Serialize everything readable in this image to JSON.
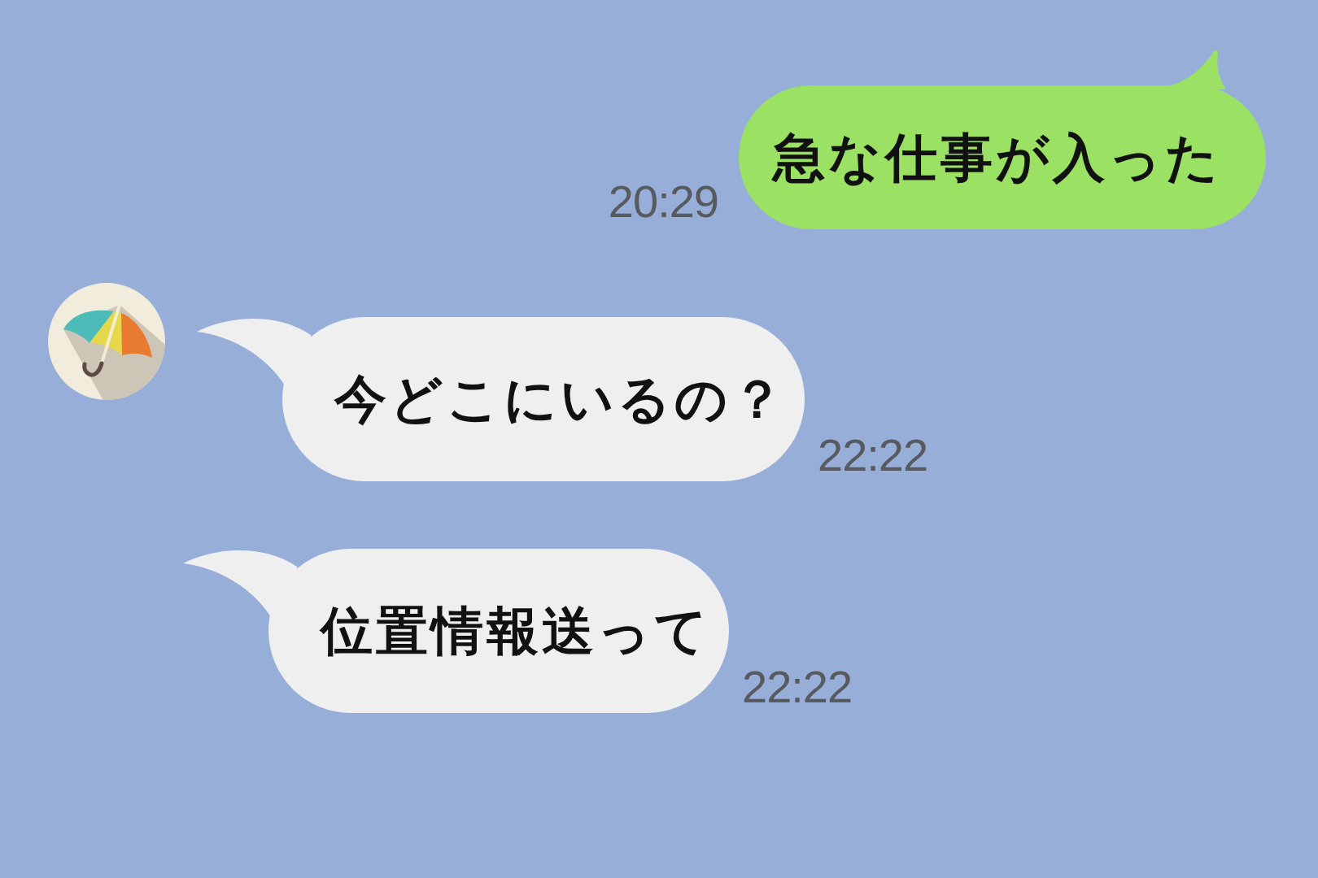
{
  "messages": [
    {
      "kind": "outgoing",
      "text": "急な仕事が入った",
      "time": "20:29",
      "avatar": false
    },
    {
      "kind": "incoming",
      "text": "今どこにいるの？",
      "time": "22:22",
      "avatar": true
    },
    {
      "kind": "incoming",
      "text": "位置情報送って",
      "time": "22:22",
      "avatar": false
    }
  ]
}
